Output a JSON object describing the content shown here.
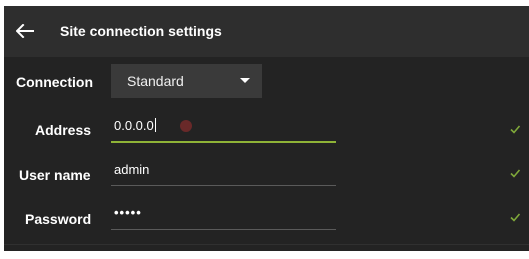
{
  "header": {
    "title": "Site connection settings",
    "back_icon": "arrow-left-icon"
  },
  "form": {
    "connection": {
      "label": "Connection",
      "value": "Standard"
    },
    "address": {
      "label": "Address",
      "value": "0.0.0.0"
    },
    "username": {
      "label": "User name",
      "value": "admin"
    },
    "password": {
      "label": "Password",
      "value": "•••••"
    }
  },
  "colors": {
    "panel_bg": "#232323",
    "header_bg": "#2e2e2e",
    "dropdown_bg": "#3a3a3a",
    "accent": "#8fb337",
    "check": "#7fa83a"
  }
}
